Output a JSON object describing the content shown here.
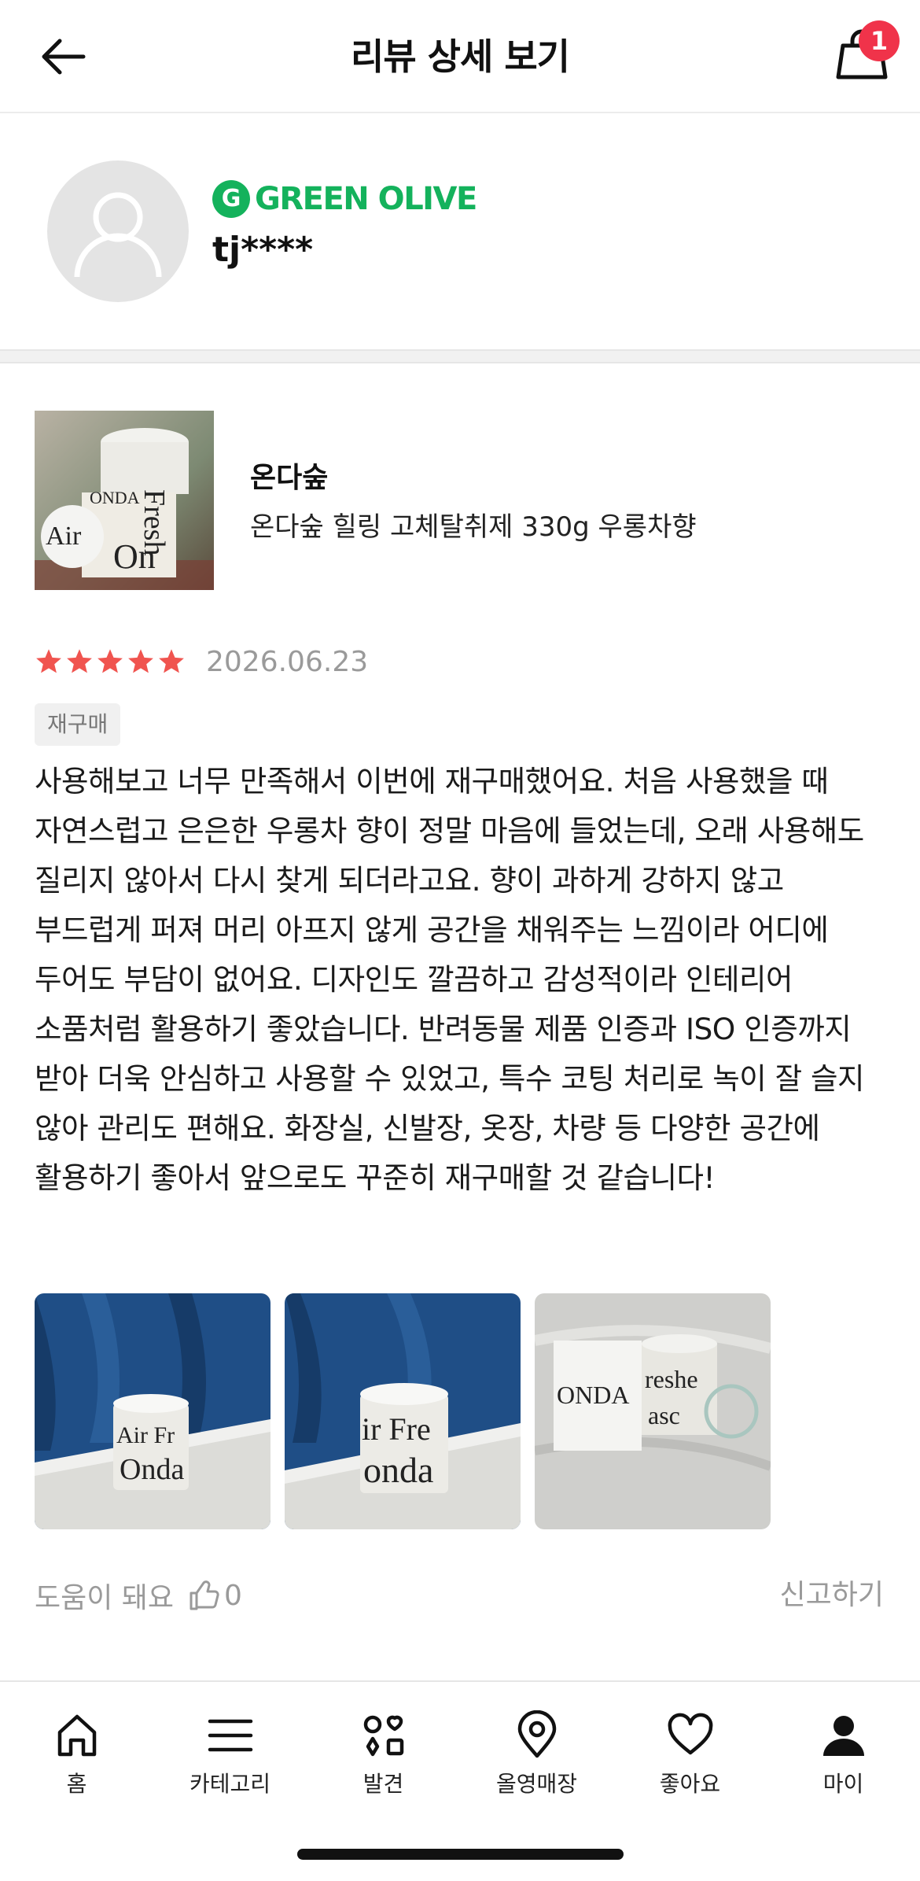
{
  "header": {
    "title": "리뷰 상세 보기",
    "cart_count": "1"
  },
  "reviewer": {
    "grade_letter": "G",
    "grade": "GREEN OLIVE",
    "user_id": "tj****"
  },
  "product": {
    "brand": "온다숲",
    "name": "온다숲 힐링 고체탈취제 330g 우롱차향"
  },
  "review": {
    "rating": 5,
    "max_rating": 5,
    "date": "2026.06.23",
    "tag": "재구매",
    "text": "사용해보고 너무 만족해서 이번에 재구매했어요. 처음 사용했을 때 자연스럽고 은은한 우롱차 향이 정말 마음에 들었는데, 오래 사용해도 질리지 않아서 다시 찾게 되더라고요. 향이 과하게 강하지 않고 부드럽게 퍼져 머리 아프지 않게 공간을 채워주는 느낌이라 어디에 두어도 부담이 없어요. 디자인도 깔끔하고 감성적이라 인테리어 소품처럼 활용하기 좋았습니다. 반려동물 제품 인증과 ISO 인증까지 받아 더욱 안심하고 사용할 수 있었고, 특수 코팅 처리로 녹이 잘 슬지 않아 관리도 편해요. 화장실, 신발장, 옷장, 차량 등 다양한 공간에 활용하기 좋아서 앞으로도 꾸준히 재구매할 것 같습니다!",
    "photo_count": 3,
    "star_color": "#f0544f"
  },
  "actions": {
    "helpful_label": "도움이 돼요",
    "helpful_count": "0",
    "report_label": "신고하기"
  },
  "tabbar": {
    "items": [
      {
        "label": "홈",
        "icon": "home-icon"
      },
      {
        "label": "카테고리",
        "icon": "menu-icon"
      },
      {
        "label": "발견",
        "icon": "discover-icon"
      },
      {
        "label": "올영매장",
        "icon": "location-pin-icon"
      },
      {
        "label": "좋아요",
        "icon": "heart-icon"
      },
      {
        "label": "마이",
        "icon": "person-icon"
      }
    ]
  },
  "colors": {
    "accent_green": "#14b25c",
    "badge_red": "#f0334a",
    "muted_text": "#9a9a9a"
  }
}
